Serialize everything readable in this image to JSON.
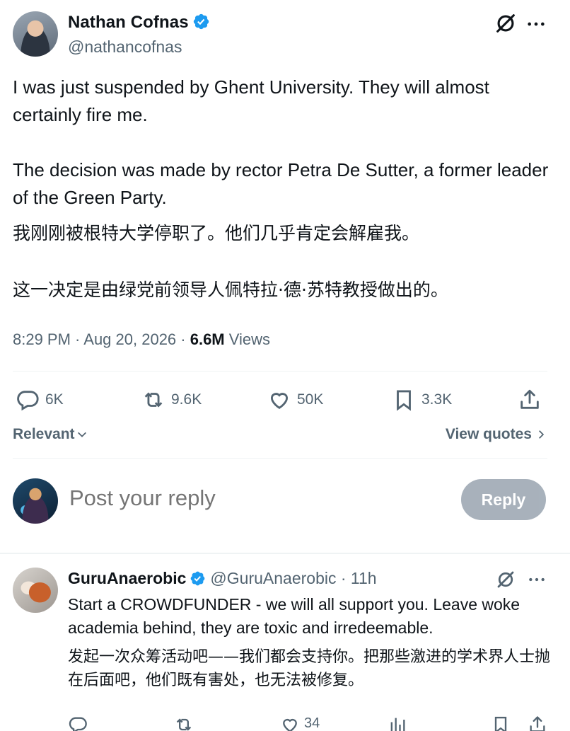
{
  "tweet": {
    "author_name": "Nathan Cofnas",
    "author_handle": "@nathancofnas",
    "text_en_1": "I was just suspended by Ghent University. They will almost certainly fire me.",
    "text_en_2": "The decision was made by rector Petra De Sutter, a former leader of the Green Party.",
    "text_zh_1": "我刚刚被根特大学停职了。他们几乎肯定会解雇我。",
    "text_zh_2": "这一决定是由绿党前领导人佩特拉·德·苏特教授做出的。",
    "time": "8:29 PM · Aug 20, 2026 · ",
    "views_count": "6.6M",
    "views_label": " Views"
  },
  "actions": {
    "replies": "6K",
    "reposts": "9.6K",
    "likes": "50K",
    "bookmarks": "3.3K"
  },
  "sort": {
    "label": "Relevant",
    "quotes_label": "View quotes"
  },
  "composer": {
    "placeholder": "Post your reply",
    "button_label": "Reply"
  },
  "reply": {
    "author_name": "GuruAnaerobic",
    "author_handle": "@GuruAnaerobic",
    "age": " · 11h",
    "text_en": "Start a CROWDFUNDER - we will all support you. Leave woke academia behind, they are toxic and irredeemable.",
    "text_zh": "发起一次众筹活动吧——我们都会支持你。把那些激进的学术界人士抛在后面吧，他们既有害处，也无法被修复。",
    "likes": "34"
  },
  "colors": {
    "text": "#0f1419",
    "secondary": "#536471",
    "verified": "#1d9bf0",
    "divider": "#eff3f4"
  }
}
